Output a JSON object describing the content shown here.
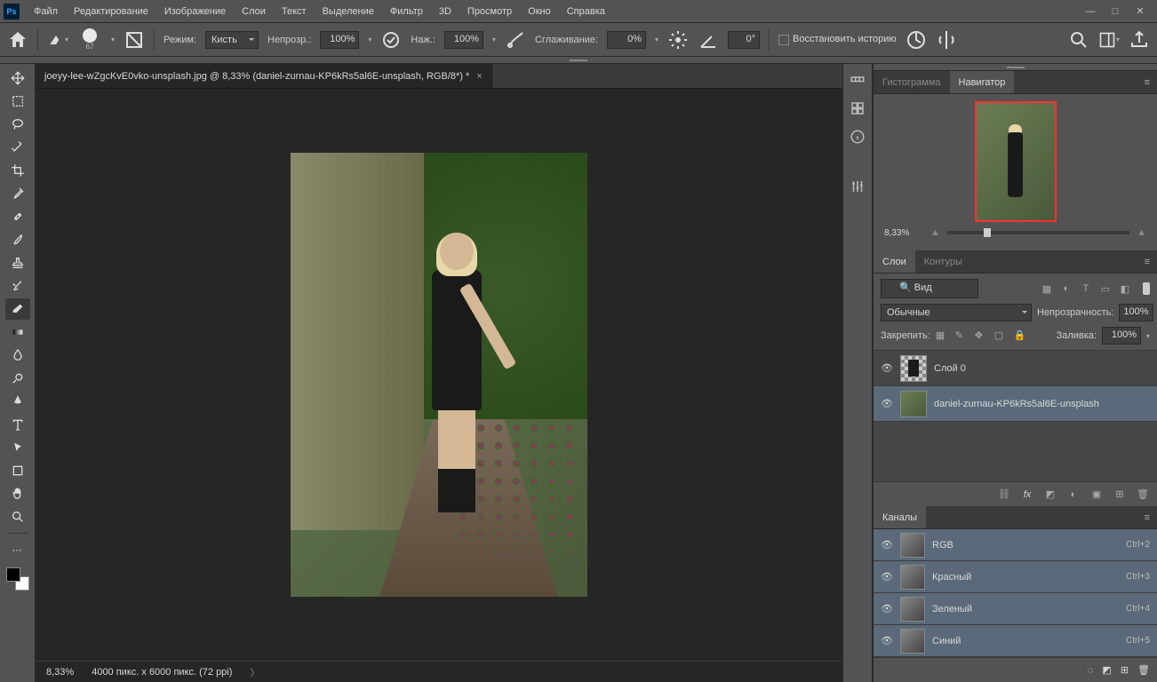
{
  "menu": {
    "items": [
      "Файл",
      "Редактирование",
      "Изображение",
      "Слои",
      "Текст",
      "Выделение",
      "Фильтр",
      "3D",
      "Просмотр",
      "Окно",
      "Справка"
    ]
  },
  "optionsbar": {
    "brush_size": "67",
    "mode_label": "Режим:",
    "mode_value": "Кисть",
    "opacity_label": "Непрозр.:",
    "opacity_value": "100%",
    "flow_label": "Наж.:",
    "flow_value": "100%",
    "smoothing_label": "Сглаживание:",
    "smoothing_value": "0%",
    "angle_value": "0°",
    "restore_label": "Восстановить историю"
  },
  "document": {
    "tab_title": "joeyy-lee-wZgcKvE0vko-unsplash.jpg @ 8,33% (daniel-zurnau-KP6kRs5al6E-unsplash, RGB/8*) *",
    "zoom": "8,33%",
    "dimensions": "4000 пикс. x 6000 пикс. (72 ppi)"
  },
  "navigator": {
    "tab_histogram": "Гистограмма",
    "tab_navigator": "Навигатор",
    "zoom": "8,33%"
  },
  "layers": {
    "tab_layers": "Слои",
    "tab_paths": "Контуры",
    "search_value": "Вид",
    "blend_mode": "Обычные",
    "opacity_label": "Непрозрачность:",
    "opacity_value": "100%",
    "lock_label": "Закрепить:",
    "fill_label": "Заливка:",
    "fill_value": "100%",
    "items": [
      {
        "name": "Слой 0"
      },
      {
        "name": "daniel-zurnau-KP6kRs5al6E-unsplash"
      }
    ]
  },
  "channels": {
    "tab": "Каналы",
    "items": [
      {
        "name": "RGB",
        "shortcut": "Ctrl+2"
      },
      {
        "name": "Красный",
        "shortcut": "Ctrl+3"
      },
      {
        "name": "Зеленый",
        "shortcut": "Ctrl+4"
      },
      {
        "name": "Синий",
        "shortcut": "Ctrl+5"
      }
    ]
  }
}
